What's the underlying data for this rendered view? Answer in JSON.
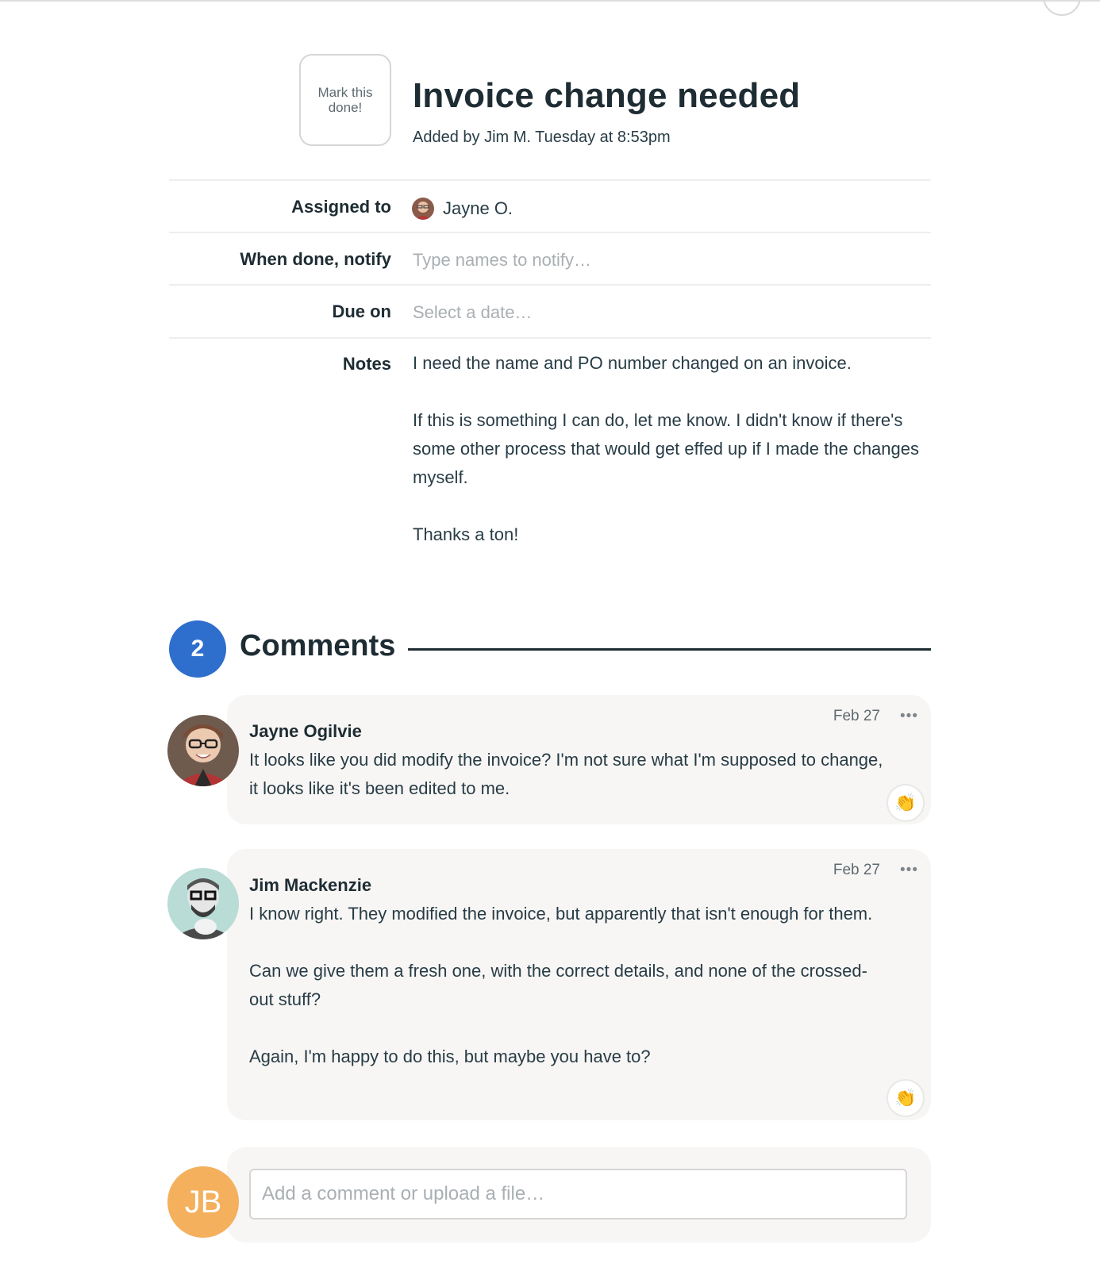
{
  "todo": {
    "mark_done_label": "Mark this done!",
    "title": "Invoice change needed",
    "added_by": "Added by Jim M. Tuesday at 8:53pm"
  },
  "fields": {
    "assigned_to_label": "Assigned to",
    "assigned_to_value": "Jayne O.",
    "notify_label": "When done, notify",
    "notify_placeholder": "Type names to notify…",
    "due_label": "Due on",
    "due_placeholder": "Select a date…",
    "notes_label": "Notes",
    "notes": [
      "I need the name and PO number changed on an invoice.",
      "If this is something I can do, let me know. I didn't know if there's some other process that would get effed up if I made the changes myself.",
      "Thanks a ton!"
    ]
  },
  "comments_section": {
    "count": "2",
    "heading": "Comments"
  },
  "comments": [
    {
      "author": "Jayne Ogilvie",
      "date": "Feb 27",
      "more": "•••",
      "boost_icon": "clapping-hands",
      "paragraphs": [
        "It looks like you did modify the invoice? I'm not sure what I'm supposed to change, it looks like it's been edited to me."
      ]
    },
    {
      "author": "Jim Mackenzie",
      "date": "Feb 27",
      "more": "•••",
      "boost_icon": "clapping-hands",
      "paragraphs": [
        "I know right. They modified the invoice, but apparently that isn't enough for them.",
        "Can we give them a fresh one, with the correct details, and none of the crossed-out stuff?",
        "Again, I'm happy to do this, but maybe you have to?"
      ]
    }
  ],
  "composer": {
    "avatar_initials": "JB",
    "placeholder": "Add a comment or upload a file…"
  },
  "colors": {
    "count_badge": "#2e6ecd",
    "composer_avatar": "#f4b05d",
    "bubble_bg": "#f7f6f4",
    "text_dark": "#1e2c33"
  }
}
